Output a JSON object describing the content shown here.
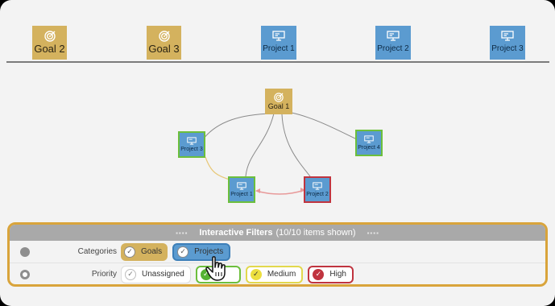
{
  "colors": {
    "goal": "#d4b25e",
    "project": "#5b9bd0",
    "panel_border": "#d9a43b",
    "low": "#54b234",
    "medium": "#ecdf3f",
    "high": "#c0343f"
  },
  "top_row": [
    {
      "label": "Goal 2",
      "kind": "goal",
      "icon": "target-icon"
    },
    {
      "label": "Goal 3",
      "kind": "goal",
      "icon": "target-icon"
    },
    {
      "label": "Project 1",
      "kind": "project",
      "icon": "presentation-icon"
    },
    {
      "label": "Project 2",
      "kind": "project",
      "icon": "presentation-icon"
    },
    {
      "label": "Project 3",
      "kind": "project",
      "icon": "presentation-icon"
    }
  ],
  "graph": {
    "nodes": [
      {
        "label": "Goal 1",
        "kind": "goal",
        "icon": "target-icon"
      },
      {
        "label": "Project 3",
        "kind": "project",
        "icon": "presentation-icon"
      },
      {
        "label": "Project 4",
        "kind": "project",
        "icon": "presentation-icon"
      },
      {
        "label": "Project 1",
        "kind": "project",
        "icon": "presentation-icon"
      },
      {
        "label": "Project 2",
        "kind": "project",
        "icon": "presentation-icon"
      }
    ]
  },
  "filters": {
    "title": "Interactive Filters",
    "count": "(10/10 items shown)",
    "categories": {
      "label": "Categories",
      "options": [
        "Goals",
        "Projects"
      ]
    },
    "priority": {
      "label": "Priority",
      "options": [
        "Unassigned",
        "Medium",
        "High"
      ]
    }
  }
}
